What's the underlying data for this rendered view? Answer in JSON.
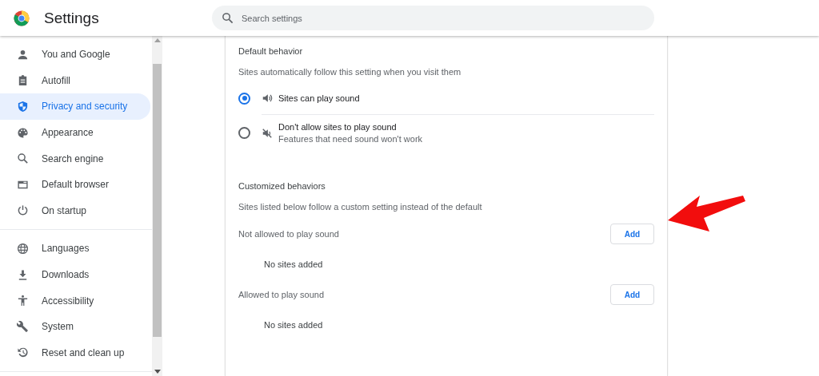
{
  "app": {
    "title": "Settings"
  },
  "search": {
    "placeholder": "Search settings"
  },
  "sidebar": {
    "groups": [
      {
        "items": [
          {
            "label": "You and Google",
            "selected": false
          },
          {
            "label": "Autofill",
            "selected": false
          },
          {
            "label": "Privacy and security",
            "selected": true
          },
          {
            "label": "Appearance",
            "selected": false
          },
          {
            "label": "Search engine",
            "selected": false
          },
          {
            "label": "Default browser",
            "selected": false
          },
          {
            "label": "On startup",
            "selected": false
          }
        ]
      },
      {
        "items": [
          {
            "label": "Languages",
            "selected": false
          },
          {
            "label": "Downloads",
            "selected": false
          },
          {
            "label": "Accessibility",
            "selected": false
          },
          {
            "label": "System",
            "selected": false
          },
          {
            "label": "Reset and clean up",
            "selected": false
          }
        ]
      }
    ]
  },
  "default_behavior": {
    "title": "Default behavior",
    "description": "Sites automatically follow this setting when you visit them",
    "options": [
      {
        "kind": "sound",
        "label": "Sites can play sound",
        "selected": true
      },
      {
        "kind": "muted",
        "label": "Don't allow sites to play sound",
        "detail": "Features that need sound won't work",
        "selected": false
      }
    ]
  },
  "customized_behaviors": {
    "title": "Customized behaviors",
    "description": "Sites listed below follow a custom setting instead of the default",
    "lists": [
      {
        "label": "Not allowed to play sound",
        "button": "Add",
        "empty_text": "No sites added"
      },
      {
        "label": "Allowed to play sound",
        "button": "Add",
        "empty_text": "No sites added"
      }
    ]
  }
}
